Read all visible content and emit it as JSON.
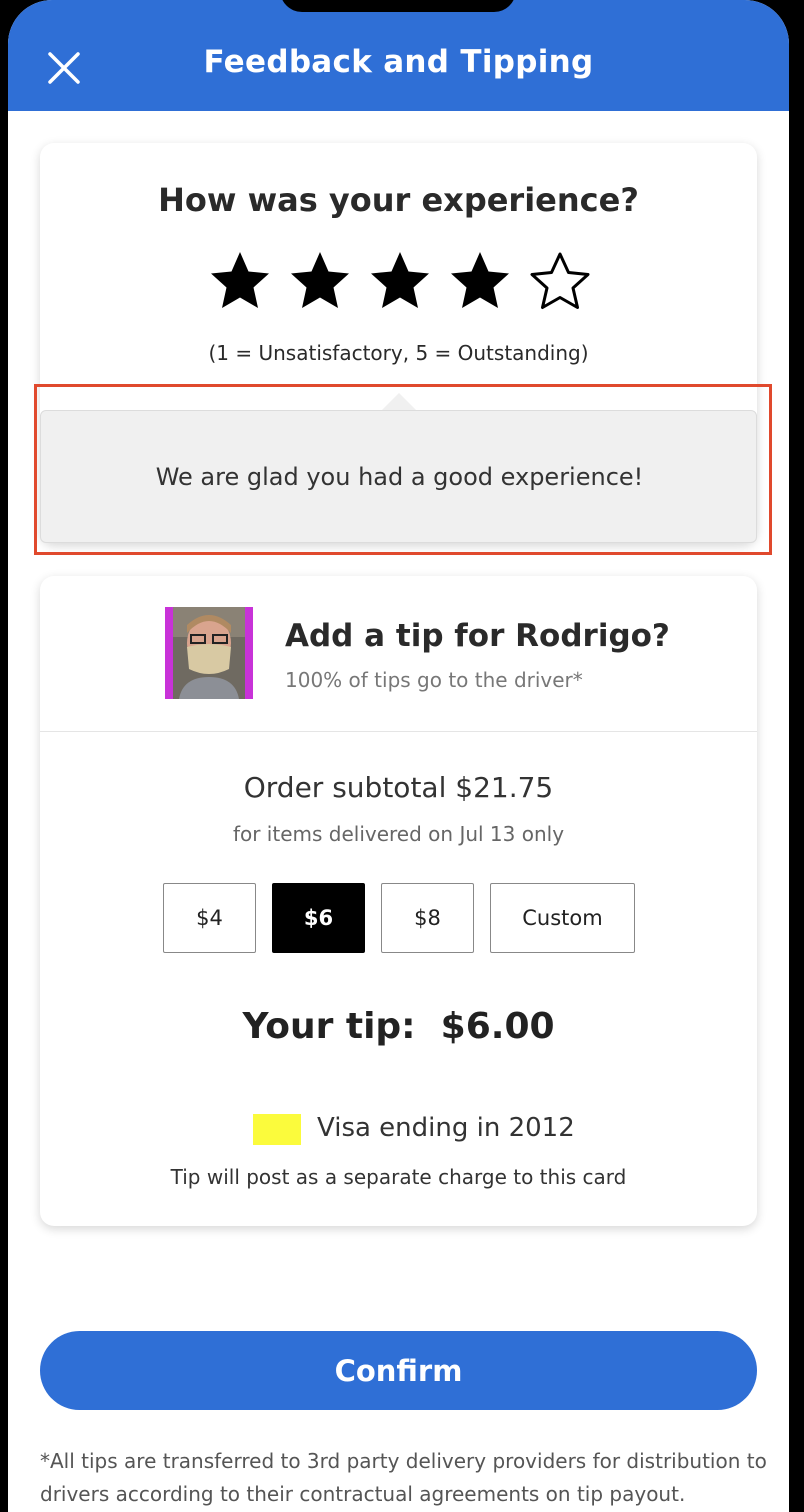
{
  "header": {
    "title": "Feedback and Tipping",
    "close_icon": "close-icon",
    "color": "#2f6fd6"
  },
  "rating": {
    "question": "How was your experience?",
    "stars_selected": 4,
    "stars_total": 5,
    "scale_hint": "(1 = Unsatisfactory, 5 = Outstanding)",
    "feedback_message": "We are glad you had a good experience!"
  },
  "tip": {
    "title": "Add a tip for Rodrigo?",
    "subtitle": "100% of tips go to the driver*",
    "subtotal": "Order subtotal $21.75",
    "subtotal_note": "for items delivered on Jul 13 only",
    "options": [
      "$4",
      "$6",
      "$8",
      "Custom"
    ],
    "selected_option": "$6",
    "your_tip_label": "Your tip:",
    "your_tip_amount": "$6.00",
    "payment_card": "Visa ending in 2012",
    "payment_note": "Tip will post as a separate charge to this card"
  },
  "confirm_label": "Confirm",
  "disclaimer": "*All tips are transferred to 3rd party delivery providers for distribution to drivers according to their contractual agreements on tip payout.",
  "colors": {
    "accent": "#2f6fd6",
    "highlight_border": "#e0492d",
    "card_swatch": "#fbfb3c",
    "photo_bg": "#c832d8"
  }
}
